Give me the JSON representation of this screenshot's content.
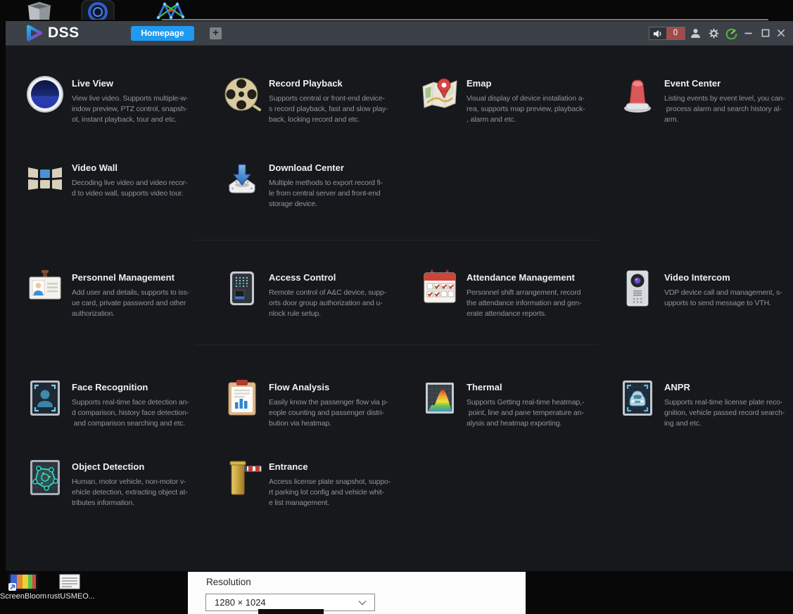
{
  "titlebar": {
    "logo_text": "DSS",
    "tab_homepage": "Homepage",
    "add_tab": "+",
    "alarm_count": "0"
  },
  "colors": {
    "accent_blue": "#1e9bf0",
    "alarm_red": "#a14b4b",
    "status_green": "#4fae3f",
    "window_bg": "#16181b",
    "titlebar_bg": "#3b4147"
  },
  "modules": [
    {
      "icon": "live-view-icon",
      "title": "Live View",
      "desc": "View live video. Supports multiple-w-\nindow preview, PTZ control, snapsh-\not, instant playback, tour and etc."
    },
    {
      "icon": "record-playback-icon",
      "title": "Record Playback",
      "desc": "Supports central or front-end device-\ns record playback, fast and slow play-\nback, locking record and etc."
    },
    {
      "icon": "emap-icon",
      "title": "Emap",
      "desc": "Visual display of device installation a-\nrea, supports map preview, playback-\n, alarm and etc."
    },
    {
      "icon": "event-center-icon",
      "title": "Event Center",
      "desc": "Listing events by event level, you can-\n process alarm and search history al-\narm."
    },
    {
      "icon": "video-wall-icon",
      "title": "Video Wall",
      "desc": "Decoding live video and video recor-\nd to video wall, supports video tour."
    },
    {
      "icon": "download-center-icon",
      "title": "Download Center",
      "desc": "Multiple methods to export record fi-\nle from central server and front-end\nstorage device."
    },
    {
      "icon": "personnel-management-icon",
      "title": "Personnel Management",
      "desc": "Add user and details, supports to iss-\nue card, private password and other\nauthorization."
    },
    {
      "icon": "access-control-icon",
      "title": "Access Control",
      "desc": "Remote control of A&C device, supp-\norts door group authorization and u-\nnlock rule setup."
    },
    {
      "icon": "attendance-management-icon",
      "title": "Attendance Management",
      "desc": "Personnel shift arrangement, record\nthe attendance information and gen-\nerate attendance reports."
    },
    {
      "icon": "video-intercom-icon",
      "title": "Video Intercom",
      "desc": "VDP device call and management, s-\nupports to send message to VTH."
    },
    {
      "icon": "face-recognition-icon",
      "title": "Face Recognition",
      "desc": "Supports real-time face detection an-\nd comparison, history face detection-\n and comparison searching and etc."
    },
    {
      "icon": "flow-analysis-icon",
      "title": "Flow Analysis",
      "desc": "Easily know the passenger flow via p-\neople counting and passenger distri-\nbution via heatmap."
    },
    {
      "icon": "thermal-icon",
      "title": "Thermal",
      "desc": "Supports Getting real-time heatmap,-\n point, line and pane temperature an-\nalysis and heatmap exporting."
    },
    {
      "icon": "anpr-icon",
      "title": "ANPR",
      "desc": "Supports real-time license plate reco-\ngnition, vehicle passed record search-\ning and etc."
    },
    {
      "icon": "object-detection-icon",
      "title": "Object Detection",
      "desc": "Human, motor vehicle, non-motor v-\nehicle detection, extracting object at-\ntributes information."
    },
    {
      "icon": "entrance-icon",
      "title": "Entrance",
      "desc": "Access license plate snapshot, suppo-\nrt parking lot config and vehicle whit-\ne list management."
    }
  ],
  "desktop": {
    "top_icons": [
      "recycle-bin-icon",
      "camera-app-icon",
      "graph-app-icon"
    ],
    "taskbar_icons": [
      {
        "label": "ScreenBloom"
      },
      {
        "label": "rustUSMEO..."
      }
    ],
    "resolution": {
      "label": "Resolution",
      "value": "1280 × 1024"
    }
  }
}
